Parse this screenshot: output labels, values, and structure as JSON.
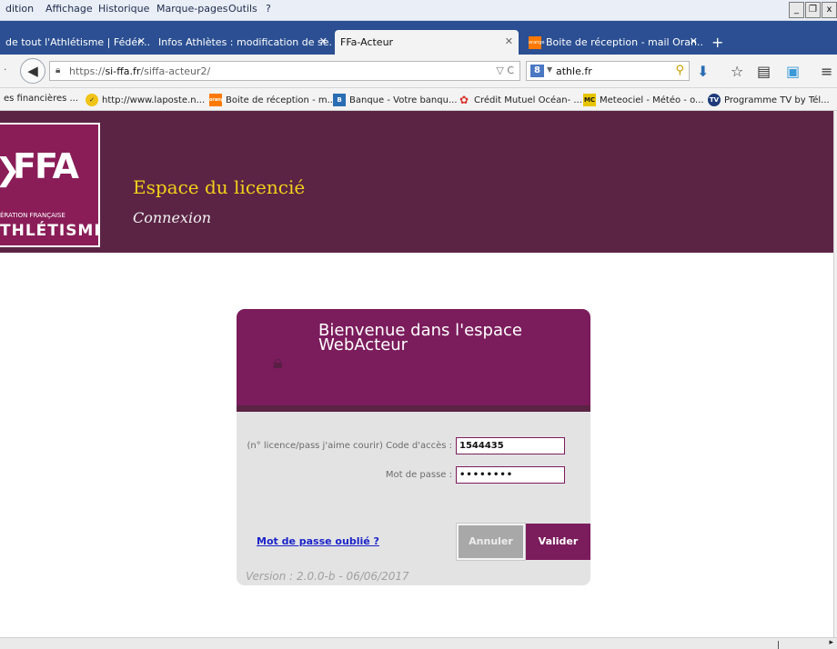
{
  "browser": {
    "menu": [
      "dition",
      "Affichage",
      "Historique",
      "Marque-pages",
      "Outils",
      "?"
    ],
    "window_controls": [
      "_",
      "5",
      "x"
    ],
    "tabs": [
      {
        "label": "de tout l'Athlétisme | Fédér...",
        "close": "✕"
      },
      {
        "label": "Infos Athlètes : modification de se...",
        "close": "✕"
      },
      {
        "label": "FFa-Acteur",
        "close": "✕"
      },
      {
        "label": "Boite de réception - mail Oran...",
        "close": "✕",
        "favicon": "orange"
      }
    ],
    "new_tab": "+",
    "url": {
      "scheme": "https://",
      "host": "si-ffa.fr",
      "path": "/siffa-acteur2/"
    },
    "url_icons": "▽ C",
    "search": {
      "engine_badge": "8",
      "value": "athle.fr"
    },
    "bookmarks": [
      {
        "label": "es financières ...",
        "icon": "",
        "color": ""
      },
      {
        "label": "http://www.laposte.n...",
        "icon": "✓",
        "color": "#f0c419"
      },
      {
        "label": "Boite de réception - m...",
        "icon": "orange",
        "color": "#ff7900"
      },
      {
        "label": "Banque - Votre banqu...",
        "icon": "B",
        "color": "#2a6db3"
      },
      {
        "label": "Crédit Mutuel Océan- ...",
        "icon": "✿",
        "color": "#d9342b"
      },
      {
        "label": "Meteociel - Météo - o...",
        "icon": "MC",
        "color": "#e7c400"
      },
      {
        "label": "Programme TV by Tél...",
        "icon": "TV",
        "color": "#1f3b7a"
      }
    ]
  },
  "site": {
    "logo": {
      "mark": "FFA",
      "line1": "ÉRATION FRANÇAISE",
      "line2": "THLÉTISME"
    },
    "title": "Espace du licencié",
    "subtitle": "Connexion"
  },
  "login": {
    "title": "Bienvenue dans l'espace WebActeur",
    "code_label": "(n° licence/pass j'aime courir) Code d'accès :",
    "code_value": "1544435",
    "password_label": "Mot de passe :",
    "password_value": "••••••••",
    "forgot_link": "Mot de passe oublié ?",
    "cancel_button": "Annuler",
    "submit_button": "Valider",
    "version": "Version : 2.0.0-b - 06/06/2017"
  },
  "colors": {
    "header_bg": "#5b2444",
    "accent": "#7b1c5c",
    "title_yellow": "#f2d11a",
    "browser_tabbar": "#2b4f92"
  }
}
